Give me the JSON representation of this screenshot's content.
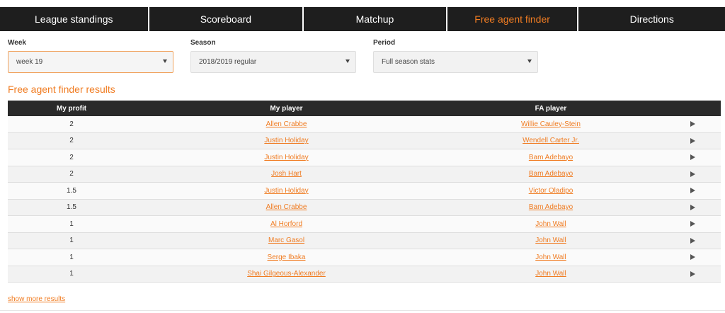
{
  "tabs": [
    {
      "label": "League standings"
    },
    {
      "label": "Scoreboard"
    },
    {
      "label": "Matchup"
    },
    {
      "label": "Free agent finder"
    },
    {
      "label": "Directions"
    }
  ],
  "filters": {
    "week": {
      "label": "Week",
      "value": "week 19"
    },
    "season": {
      "label": "Season",
      "value": "2018/2019 regular"
    },
    "period": {
      "label": "Period",
      "value": "Full season stats"
    }
  },
  "results": {
    "title": "Free agent finder results",
    "columns": [
      "My profit",
      "My player",
      "FA player"
    ],
    "rows": [
      {
        "profit": "2",
        "my_player": "Allen Crabbe",
        "fa_player": "Willie Cauley-Stein"
      },
      {
        "profit": "2",
        "my_player": "Justin Holiday",
        "fa_player": "Wendell Carter Jr."
      },
      {
        "profit": "2",
        "my_player": "Justin Holiday",
        "fa_player": "Bam Adebayo"
      },
      {
        "profit": "2",
        "my_player": "Josh Hart",
        "fa_player": "Bam Adebayo"
      },
      {
        "profit": "1.5",
        "my_player": "Justin Holiday",
        "fa_player": "Victor Oladipo"
      },
      {
        "profit": "1.5",
        "my_player": "Allen Crabbe",
        "fa_player": "Bam Adebayo"
      },
      {
        "profit": "1",
        "my_player": "Al Horford",
        "fa_player": "John Wall"
      },
      {
        "profit": "1",
        "my_player": "Marc Gasol",
        "fa_player": "John Wall"
      },
      {
        "profit": "1",
        "my_player": "Serge Ibaka",
        "fa_player": "John Wall"
      },
      {
        "profit": "1",
        "my_player": "Shai Gilgeous-Alexander",
        "fa_player": "John Wall"
      }
    ],
    "show_more": "show more results"
  },
  "colors": {
    "accent": "#f07c22",
    "header_bg": "#1e1e1e"
  },
  "icons": {
    "row_action": "play-icon",
    "select": "caret-down-icon"
  }
}
